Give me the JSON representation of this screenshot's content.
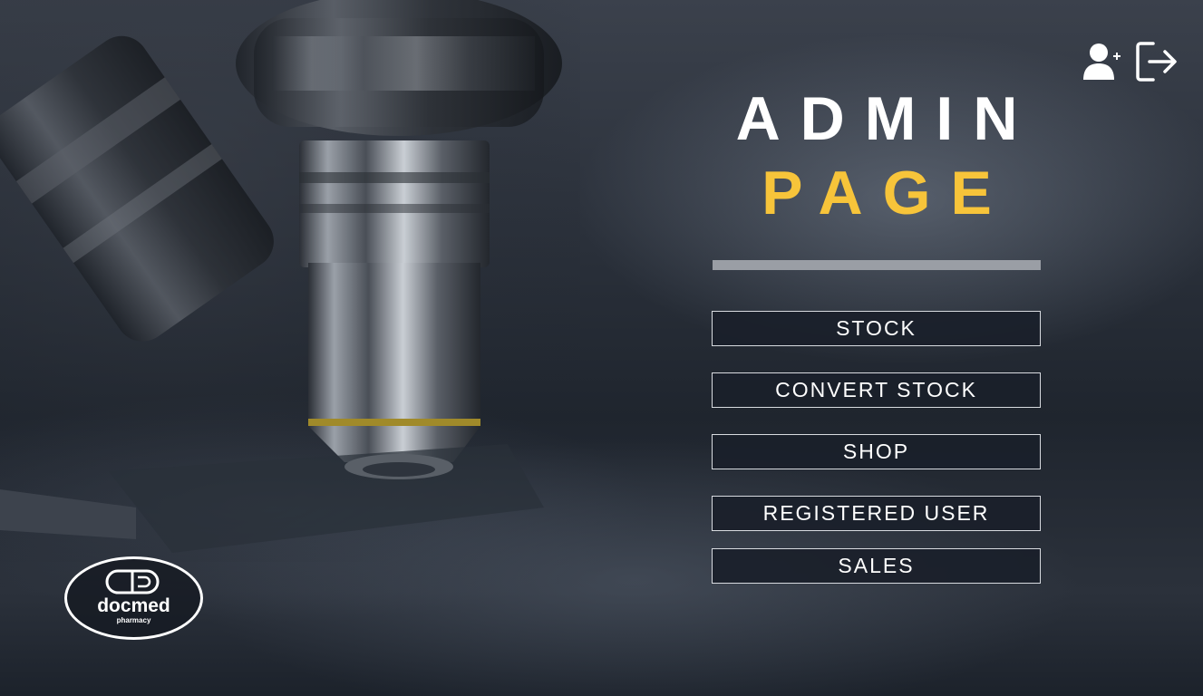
{
  "header": {
    "title_line1": "ADMIN",
    "title_line2": "PAGE",
    "title_color": "#ffffff",
    "accent_color": "#f7c43a"
  },
  "toolbar": {
    "add_user_icon": "add-user-icon",
    "logout_icon": "logout-icon"
  },
  "menu": {
    "items": [
      {
        "label": "STOCK"
      },
      {
        "label": "CONVERT STOCK"
      },
      {
        "label": "SHOP"
      },
      {
        "label": "REGISTERED USER"
      },
      {
        "label": "SALES"
      }
    ]
  },
  "logo": {
    "name": "docmed",
    "tagline": "pharmacy"
  },
  "background": {
    "image": "microscope-photo"
  }
}
